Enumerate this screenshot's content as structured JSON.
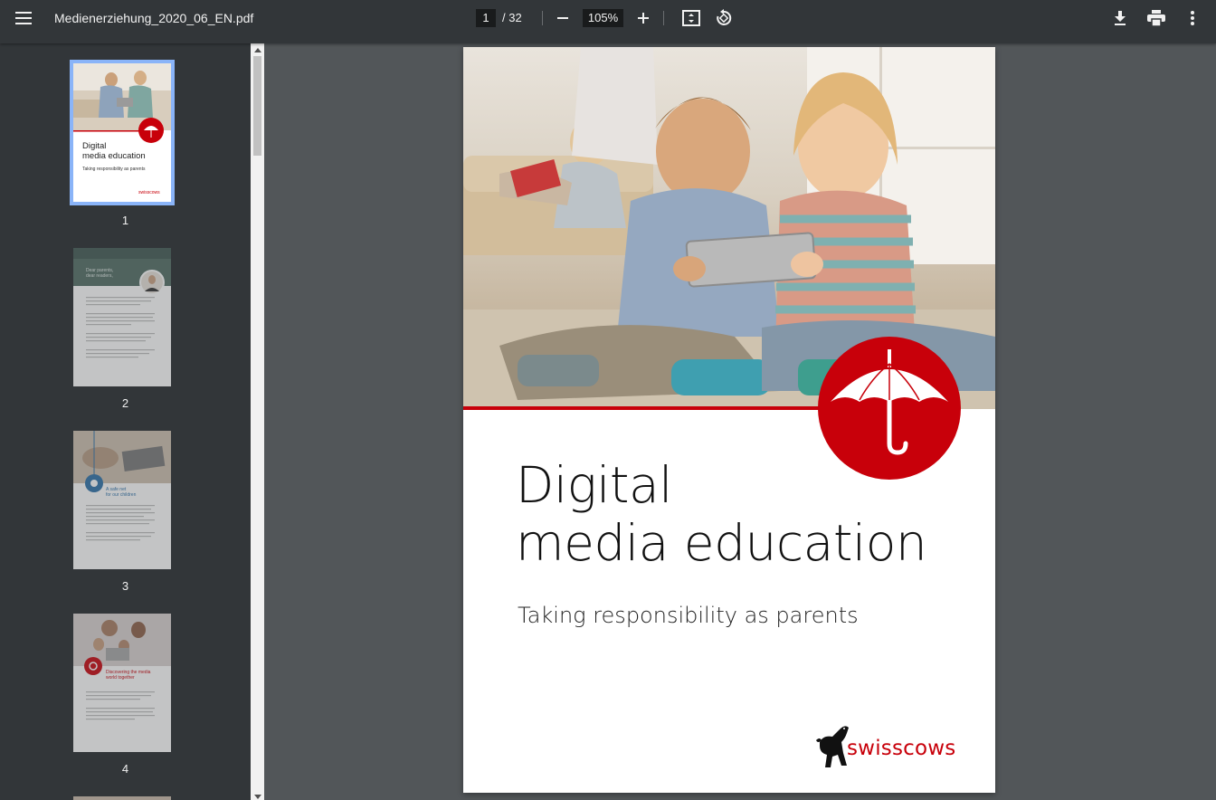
{
  "toolbar": {
    "title": "Medienerziehung_2020_06_EN.pdf",
    "current_page": "1",
    "page_separator": "/ 32",
    "zoom": "105%"
  },
  "sidebar": {
    "thumbnails": [
      {
        "number": "1",
        "title_line1": "Digital",
        "title_line2": "media education",
        "subtitle": "Taking responsibility as parents",
        "logo": "swisscows"
      },
      {
        "number": "2",
        "heading_line1": "Dear parents,",
        "heading_line2": "dear readers,"
      },
      {
        "number": "3",
        "heading_line1": "A safe net",
        "heading_line2": "for our children"
      },
      {
        "number": "4",
        "heading_line1": "Discovering the media",
        "heading_line2": "world together"
      }
    ]
  },
  "document": {
    "title_line1": "Digital",
    "title_line2": "media education",
    "subtitle": "Taking responsibility as parents",
    "logo_text": "swisscows",
    "accent_color": "#c8000a"
  },
  "icons": {
    "menu": "hamburger-menu-icon",
    "zoom_out": "minus-icon",
    "zoom_in": "plus-icon",
    "fit": "fit-to-page-icon",
    "rotate": "rotate-icon",
    "download": "download-icon",
    "print": "print-icon",
    "more": "more-vertical-icon"
  }
}
